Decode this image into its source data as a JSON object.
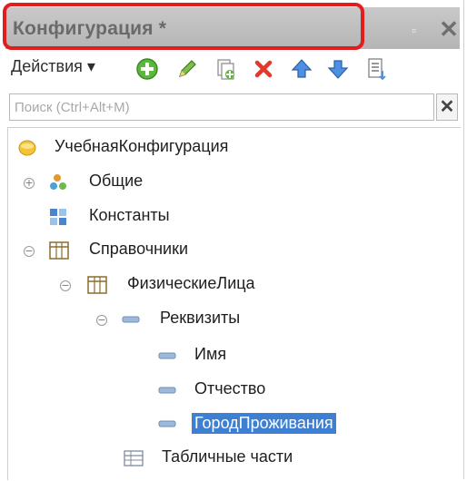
{
  "window": {
    "title": "Конфигурация *",
    "pin_glyph": "▫",
    "close_glyph": "✕"
  },
  "toolbar": {
    "actions_label": "Действия ▾",
    "icons": [
      "add-icon",
      "edit-icon",
      "copy-icon",
      "delete-icon",
      "move-up-icon",
      "move-down-icon",
      "list-icon"
    ]
  },
  "search": {
    "placeholder": "Поиск (Ctrl+Alt+M)",
    "value": "",
    "clear_glyph": "✕"
  },
  "tree": {
    "root": "УчебнаяКонфигурация",
    "common": "Общие",
    "constants": "Константы",
    "catalogs": "Справочники",
    "individuals": "ФизическиеЛица",
    "attributes": "Реквизиты",
    "attr_name": "Имя",
    "attr_patronymic": "Отчество",
    "attr_city": "ГородПроживания",
    "tabular_parts": "Табличные части",
    "expander_plus": "+",
    "expander_minus": "−"
  },
  "colors": {
    "highlight_border": "#e01e1e",
    "selection": "#3d7fd2",
    "titlebar": "#bebebe"
  }
}
